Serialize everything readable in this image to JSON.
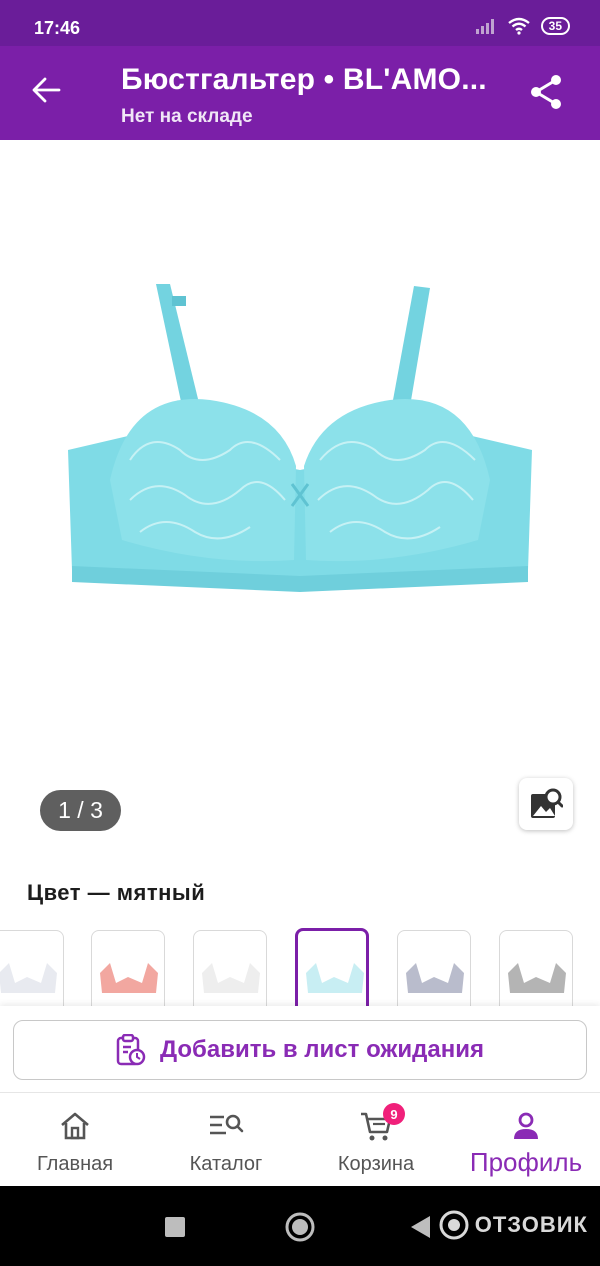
{
  "status_bar": {
    "time": "17:46",
    "battery": "35"
  },
  "header": {
    "title": "Бюстгальтер • BL'AMO...",
    "subtitle": "Нет на складе"
  },
  "gallery": {
    "counter": "1 / 3"
  },
  "color": {
    "label": "Цвет — мятный"
  },
  "swatches": [
    "white",
    "pink",
    "white",
    "mint",
    "grey-blue",
    "grey"
  ],
  "wait_button": {
    "label": "Добавить в лист ожидания"
  },
  "bottom_nav": {
    "home": "Главная",
    "catalog": "Каталог",
    "cart": "Корзина",
    "cart_badge": "9",
    "profile": "Профиль"
  },
  "watermark": "ОТЗОВИК",
  "colors": {
    "brand": "#7b1fa8",
    "accent_text": "#8a2bb5",
    "badge": "#f0207a",
    "product": "#7fdbe6"
  }
}
